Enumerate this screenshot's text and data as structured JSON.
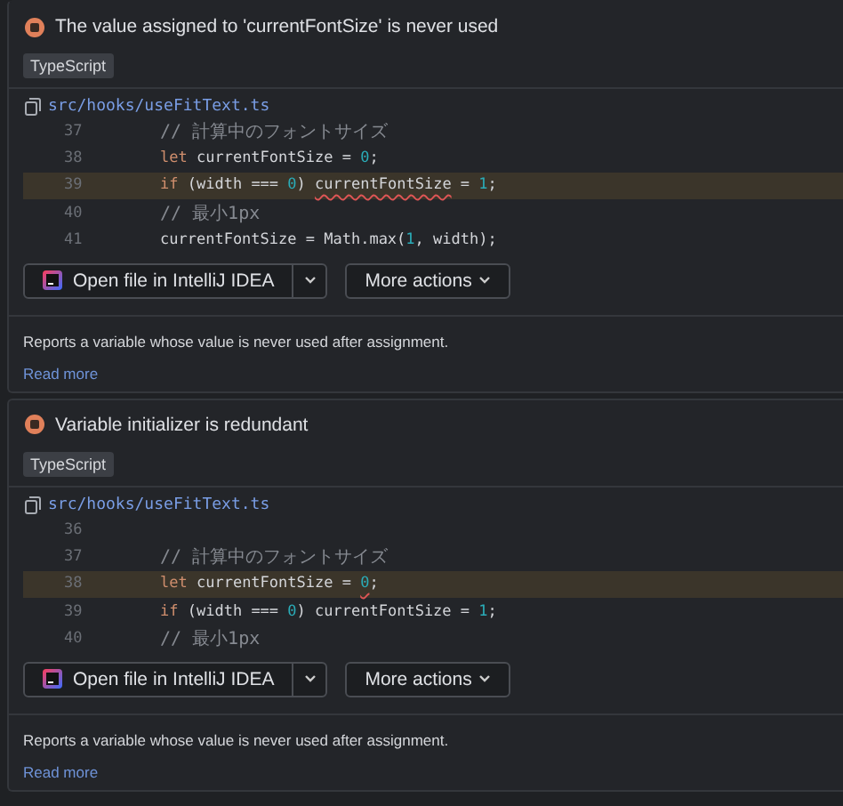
{
  "problems": [
    {
      "title": "The value assigned to 'currentFontSize' is never used",
      "tag": "TypeScript",
      "file": "src/hooks/useFitText.ts",
      "lines": [
        {
          "number": "37",
          "highlighted": false,
          "tokens": [
            {
              "text": "// 計算中のフォントサイズ",
              "kind": "comment",
              "warning": false
            }
          ]
        },
        {
          "number": "38",
          "highlighted": false,
          "tokens": [
            {
              "text": "let",
              "kind": "keyword",
              "warning": false
            },
            {
              "text": " currentFontSize = ",
              "kind": "plain",
              "warning": false
            },
            {
              "text": "0",
              "kind": "number",
              "warning": false
            },
            {
              "text": ";",
              "kind": "plain",
              "warning": false
            }
          ]
        },
        {
          "number": "39",
          "highlighted": true,
          "tokens": [
            {
              "text": "if",
              "kind": "keyword",
              "warning": false
            },
            {
              "text": " (width === ",
              "kind": "plain",
              "warning": false
            },
            {
              "text": "0",
              "kind": "number",
              "warning": false
            },
            {
              "text": ") ",
              "kind": "plain",
              "warning": false
            },
            {
              "text": "currentFontSize",
              "kind": "plain",
              "warning": true
            },
            {
              "text": " = ",
              "kind": "plain",
              "warning": false
            },
            {
              "text": "1",
              "kind": "number",
              "warning": false
            },
            {
              "text": ";",
              "kind": "plain",
              "warning": false
            }
          ]
        },
        {
          "number": "40",
          "highlighted": false,
          "tokens": [
            {
              "text": "// 最小1px",
              "kind": "comment",
              "warning": false
            }
          ]
        },
        {
          "number": "41",
          "highlighted": false,
          "tokens": [
            {
              "text": "currentFontSize = Math.max(",
              "kind": "plain",
              "warning": false
            },
            {
              "text": "1",
              "kind": "number",
              "warning": false
            },
            {
              "text": ", width);",
              "kind": "plain",
              "warning": false
            }
          ]
        }
      ],
      "open_button": "Open file in IntelliJ IDEA",
      "more_button": "More actions",
      "description": "Reports a variable whose value is never used after assignment.",
      "read_more": "Read more"
    },
    {
      "title": "Variable initializer is redundant",
      "tag": "TypeScript",
      "file": "src/hooks/useFitText.ts",
      "lines": [
        {
          "number": "36",
          "highlighted": false
        },
        {
          "number": "37",
          "highlighted": false,
          "tokens": [
            {
              "text": "// 計算中のフォントサイズ",
              "kind": "comment",
              "warning": false
            }
          ]
        },
        {
          "number": "38",
          "highlighted": true,
          "tokens": [
            {
              "text": "let",
              "kind": "keyword",
              "warning": false
            },
            {
              "text": " currentFontSize = ",
              "kind": "plain",
              "warning": false
            },
            {
              "text": "0",
              "kind": "number",
              "warning": true
            },
            {
              "text": ";",
              "kind": "plain",
              "warning": false
            }
          ]
        },
        {
          "number": "39",
          "highlighted": false,
          "tokens": [
            {
              "text": "if",
              "kind": "keyword",
              "warning": false
            },
            {
              "text": " (width === ",
              "kind": "plain",
              "warning": false
            },
            {
              "text": "0",
              "kind": "number",
              "warning": false
            },
            {
              "text": ") currentFontSize = ",
              "kind": "plain",
              "warning": false
            },
            {
              "text": "1",
              "kind": "number",
              "warning": false
            },
            {
              "text": ";",
              "kind": "plain",
              "warning": false
            }
          ]
        },
        {
          "number": "40",
          "highlighted": false,
          "tokens": [
            {
              "text": "// 最小1px",
              "kind": "comment",
              "warning": false
            }
          ]
        }
      ],
      "open_button": "Open file in IntelliJ IDEA",
      "more_button": "More actions",
      "description": "Reports a variable whose value is never used after assignment.",
      "read_more": "Read more"
    }
  ]
}
